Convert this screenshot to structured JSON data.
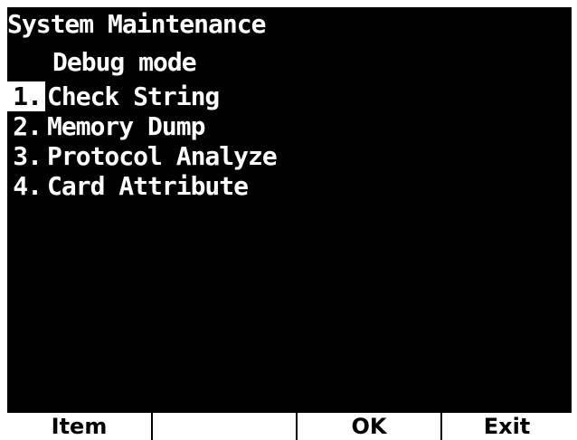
{
  "screen": {
    "title": "System Maintenance",
    "subtitle": "Debug mode"
  },
  "menu": {
    "items": [
      {
        "number": "1.",
        "label": "Check String",
        "selected": true
      },
      {
        "number": "2.",
        "label": "Memory Dump",
        "selected": false
      },
      {
        "number": "3.",
        "label": "Protocol Analyze",
        "selected": false
      },
      {
        "number": "4.",
        "label": "Card Attribute",
        "selected": false
      }
    ]
  },
  "softkeys": {
    "key1": "Item",
    "key2": "",
    "key3": "OK",
    "key4": "Exit"
  },
  "colors": {
    "background": "#000000",
    "foreground": "#ffffff",
    "highlight": "#ffffff"
  }
}
